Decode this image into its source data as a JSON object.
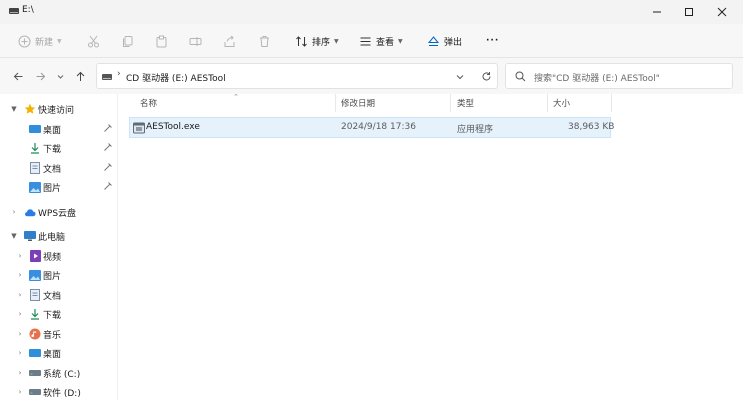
{
  "window": {
    "title": "E:\\"
  },
  "toolbar": {
    "new_label": "新建",
    "sort_label": "排序",
    "view_label": "查看",
    "eject_label": "弹出",
    "more_label": "···"
  },
  "address": {
    "separator": "›",
    "path": "CD 驱动器 (E:) AESTool"
  },
  "search": {
    "placeholder": "搜索\"CD 驱动器 (E:) AESTool\""
  },
  "sidebar": {
    "quick_access": "快速访问",
    "quick_items": [
      {
        "label": "桌面",
        "icon": "desktop-icon"
      },
      {
        "label": "下载",
        "icon": "download-icon"
      },
      {
        "label": "文档",
        "icon": "document-icon"
      },
      {
        "label": "图片",
        "icon": "picture-icon"
      }
    ],
    "wps_cloud": "WPS云盘",
    "this_pc": "此电脑",
    "pc_items": [
      {
        "label": "视频",
        "icon": "video-icon"
      },
      {
        "label": "图片",
        "icon": "picture-icon"
      },
      {
        "label": "文档",
        "icon": "document-icon"
      },
      {
        "label": "下载",
        "icon": "download-icon"
      },
      {
        "label": "音乐",
        "icon": "music-icon"
      },
      {
        "label": "桌面",
        "icon": "desktop-icon"
      },
      {
        "label": "系统 (C:)",
        "icon": "drive-icon"
      },
      {
        "label": "软件 (D:)",
        "icon": "drive-icon"
      }
    ]
  },
  "columns": {
    "name": "名称",
    "modified": "修改日期",
    "type": "类型",
    "size": "大小"
  },
  "files": [
    {
      "name": "AESTool.exe",
      "modified": "2024/9/18 17:36",
      "type": "应用程序",
      "size": "38,963 KB"
    }
  ],
  "colors": {
    "accent": "#0067c0",
    "selection": "#e5f1fb",
    "folder_blue": "#2f8fd8"
  }
}
